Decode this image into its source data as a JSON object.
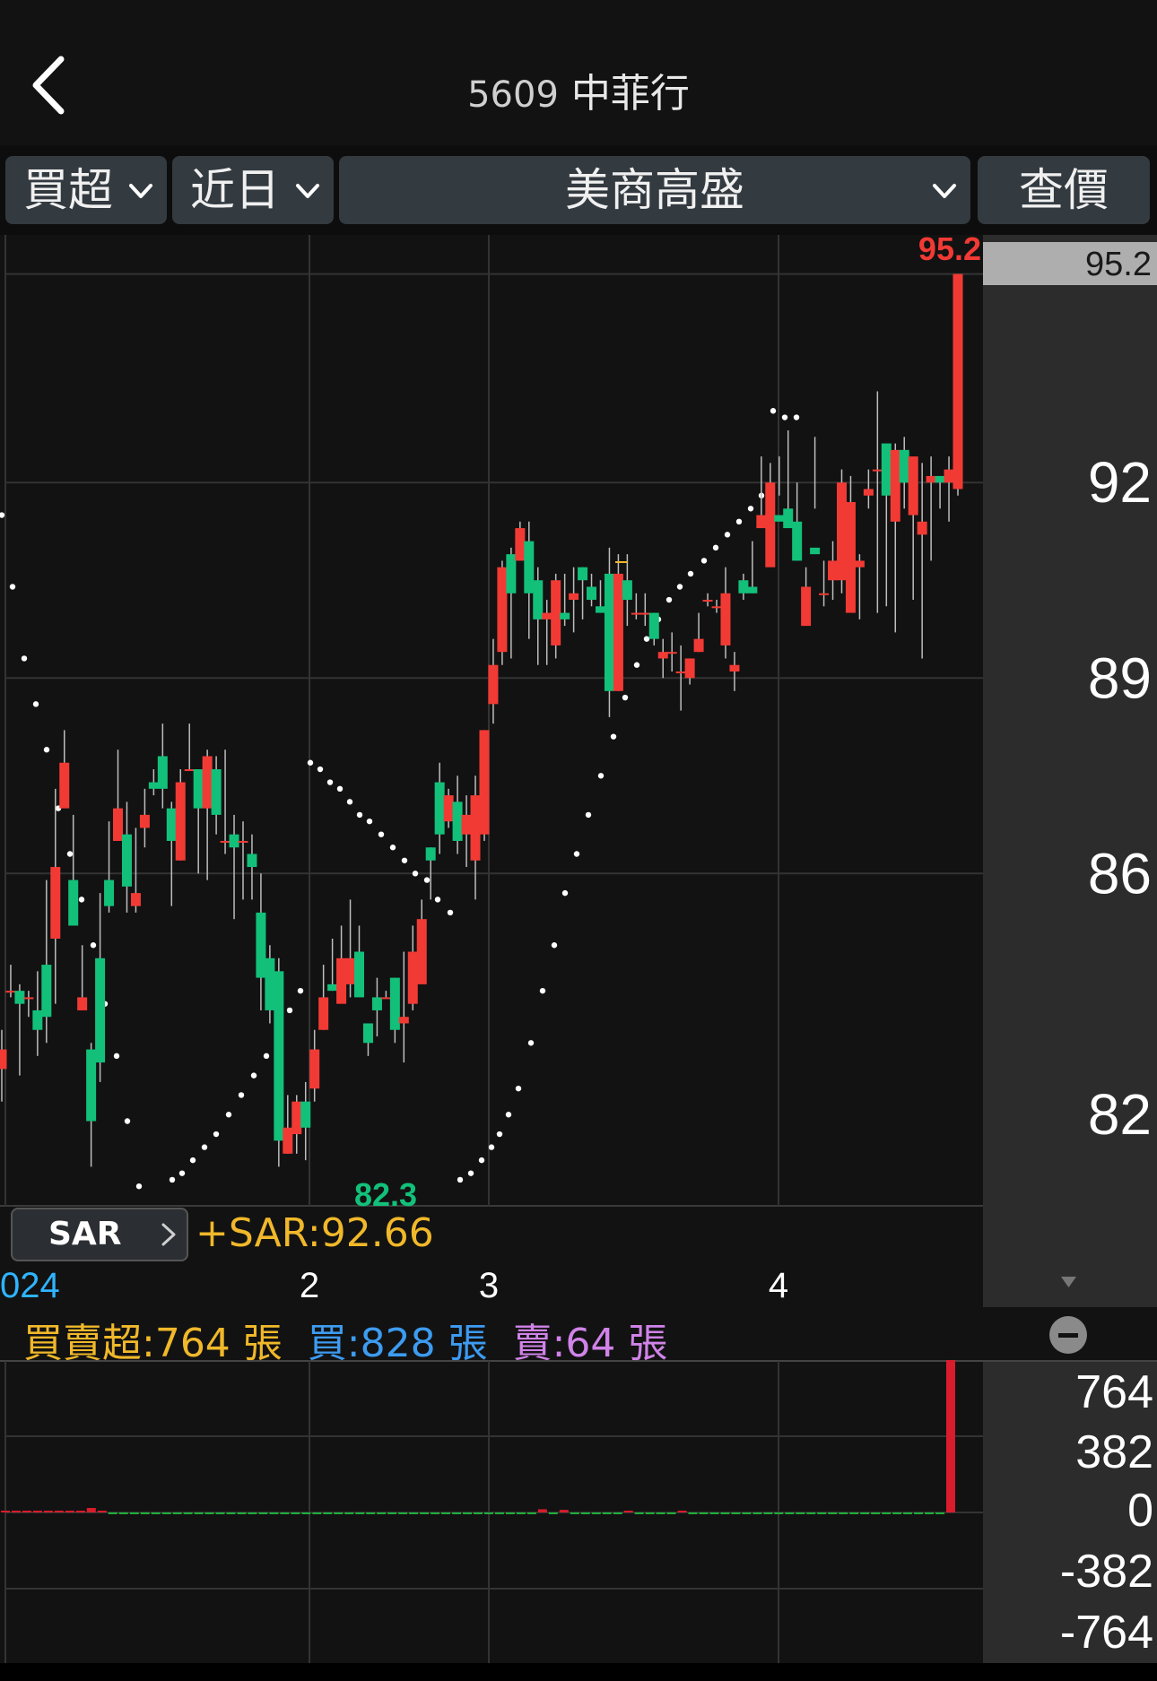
{
  "header": {
    "code": "5609",
    "name": "中菲行"
  },
  "toolbar": {
    "mode": "買超",
    "period": "近日",
    "broker": "美商高盛",
    "query": "查價"
  },
  "price_axis": {
    "labels": [
      "95.2",
      "92",
      "89",
      "86",
      "82"
    ],
    "current_price": "95.2",
    "high_label": "95.2",
    "low_label": "82.3"
  },
  "date_axis": [
    "024",
    "2",
    "3",
    "4"
  ],
  "sar": {
    "button": "SAR",
    "value": "+SAR:92.66"
  },
  "volume_legend": {
    "net": "買賣超:764 張",
    "buy": "買:828 張",
    "sell": "賣:64 張"
  },
  "volume_axis": [
    "764",
    "382",
    "0",
    "-382",
    "-764"
  ],
  "colors": {
    "up": "#f23a35",
    "down": "#12c07a",
    "sar": "#f0b82a",
    "buy": "#3d9bf0",
    "sell": "#d083e8"
  },
  "chart_data": {
    "type": "candlestick",
    "yrange": [
      80.9,
      95.8
    ],
    "candles": [
      [
        83.0,
        83.3,
        83.6,
        82.5
      ],
      [
        84.2,
        84.2,
        84.6,
        84.1
      ],
      [
        84.2,
        84.0,
        84.3,
        82.9
      ],
      [
        84.1,
        84.1,
        84.2,
        83.8
      ],
      [
        83.9,
        83.6,
        84.5,
        83.2
      ],
      [
        84.6,
        83.8,
        85.9,
        83.4
      ],
      [
        85.0,
        86.1,
        87.3,
        84.0
      ],
      [
        87.0,
        87.7,
        88.2,
        87.7
      ],
      [
        85.9,
        85.2,
        86.9,
        85.5
      ],
      [
        83.9,
        84.1,
        84.9,
        84.1
      ],
      [
        83.3,
        82.2,
        83.4,
        81.5
      ],
      [
        84.7,
        83.1,
        85.7,
        82.8
      ],
      [
        85.9,
        85.5,
        86.8,
        85.4
      ],
      [
        86.5,
        87.0,
        87.9,
        86.8
      ],
      [
        86.6,
        85.8,
        87.1,
        85.4
      ],
      [
        85.5,
        85.7,
        86.7,
        85.4
      ],
      [
        86.7,
        86.9,
        87.3,
        86.4
      ],
      [
        87.4,
        87.3,
        87.6,
        87.2
      ],
      [
        87.8,
        87.3,
        88.3,
        87.0
      ],
      [
        87.0,
        86.5,
        87.1,
        85.5
      ],
      [
        86.2,
        87.4,
        87.6,
        86.2
      ],
      [
        87.6,
        87.6,
        88.3,
        87.6
      ],
      [
        87.6,
        87.0,
        87.6,
        86.0
      ],
      [
        87.0,
        87.8,
        87.9,
        85.9
      ],
      [
        87.6,
        86.9,
        87.8,
        86.6
      ],
      [
        86.5,
        86.5,
        87.9,
        86.3
      ],
      [
        86.6,
        86.4,
        86.9,
        85.3
      ],
      [
        86.5,
        86.5,
        86.8,
        85.6
      ],
      [
        86.3,
        86.1,
        86.6,
        85.6
      ],
      [
        85.4,
        84.4,
        86.0,
        83.9
      ],
      [
        84.7,
        83.9,
        84.9,
        83.7
      ],
      [
        84.5,
        81.9,
        84.7,
        81.5
      ],
      [
        81.7,
        82.1,
        82.6,
        81.7
      ],
      [
        82.0,
        82.5,
        82.6,
        81.7
      ],
      [
        82.5,
        82.1,
        82.8,
        81.6
      ],
      [
        82.7,
        83.3,
        83.6,
        82.5
      ],
      [
        83.6,
        84.1,
        84.6,
        83.6
      ],
      [
        84.3,
        84.2,
        85.0,
        84.2
      ],
      [
        84.0,
        84.7,
        85.2,
        84.1
      ],
      [
        84.3,
        84.7,
        85.6,
        84.1
      ],
      [
        84.8,
        84.1,
        85.2,
        84.4
      ],
      [
        83.7,
        83.4,
        83.7,
        83.2
      ],
      [
        84.1,
        83.9,
        84.4,
        83.5
      ],
      [
        84.1,
        84.1,
        84.2,
        84.1
      ],
      [
        84.4,
        83.6,
        84.4,
        83.4
      ],
      [
        83.7,
        83.8,
        84.8,
        83.1
      ],
      [
        84.0,
        84.8,
        85.2,
        83.9
      ],
      [
        84.3,
        85.3,
        85.6,
        84.6
      ],
      [
        86.4,
        86.2,
        86.4,
        85.6
      ],
      [
        87.4,
        86.6,
        87.7,
        86.3
      ],
      [
        86.8,
        87.2,
        87.3,
        86.7
      ],
      [
        87.1,
        86.5,
        87.5,
        86.3
      ],
      [
        86.6,
        86.9,
        87.2,
        86.1
      ],
      [
        86.2,
        87.2,
        87.5,
        85.6
      ],
      [
        86.6,
        88.2,
        88.2,
        86.5
      ],
      [
        88.6,
        89.2,
        89.6,
        88.3
      ],
      [
        89.4,
        90.7,
        90.8,
        89.2
      ],
      [
        90.9,
        90.3,
        91.0,
        89.3
      ],
      [
        90.8,
        91.3,
        91.4,
        90.9
      ],
      [
        91.1,
        90.3,
        91.4,
        89.6
      ],
      [
        90.5,
        89.9,
        90.7,
        89.2
      ],
      [
        89.9,
        90.0,
        90.2,
        89.2
      ],
      [
        89.5,
        90.5,
        90.6,
        89.3
      ],
      [
        90.0,
        89.9,
        90.6,
        89.8
      ],
      [
        90.2,
        90.3,
        90.7,
        89.7
      ],
      [
        90.7,
        90.5,
        90.7,
        89.9
      ],
      [
        90.4,
        90.2,
        90.6,
        90.1
      ],
      [
        90.1,
        90.0,
        90.5,
        90.0
      ],
      [
        90.6,
        88.8,
        91.0,
        88.4
      ],
      [
        88.8,
        90.6,
        90.9,
        88.8
      ],
      [
        90.5,
        90.2,
        90.9,
        89.8
      ],
      [
        90.0,
        90.0,
        90.3,
        89.9
      ],
      [
        90.0,
        90.0,
        90.3,
        89.8
      ],
      [
        90.0,
        89.6,
        90.0,
        89.5
      ],
      [
        89.3,
        89.4,
        89.6,
        89.0
      ],
      [
        89.4,
        89.4,
        89.7,
        89.1
      ],
      [
        89.1,
        89.1,
        89.5,
        88.5
      ],
      [
        89.0,
        89.3,
        89.3,
        88.9
      ],
      [
        89.4,
        89.6,
        90.0,
        89.4
      ],
      [
        90.2,
        90.2,
        90.3,
        90.1
      ],
      [
        90.1,
        90.1,
        90.2,
        90.0
      ],
      [
        89.5,
        90.3,
        90.7,
        89.3
      ],
      [
        89.1,
        89.2,
        89.4,
        88.8
      ],
      [
        90.5,
        90.3,
        90.6,
        90.2
      ],
      [
        90.4,
        90.3,
        91.1,
        90.3
      ],
      [
        91.3,
        91.5,
        92.4,
        91.5
      ],
      [
        90.7,
        92.0,
        92.3,
        91.1
      ],
      [
        91.5,
        91.4,
        92.4,
        91.8
      ],
      [
        91.6,
        91.3,
        92.8,
        91.4
      ],
      [
        91.4,
        90.8,
        92.0,
        90.8
      ],
      [
        89.8,
        90.4,
        90.7,
        89.9
      ],
      [
        91.0,
        90.9,
        92.7,
        91.6
      ],
      [
        90.3,
        90.3,
        90.8,
        90.1
      ],
      [
        90.5,
        90.8,
        91.1,
        90.2
      ],
      [
        90.5,
        92.0,
        92.2,
        90.3
      ],
      [
        90.0,
        91.7,
        92.1,
        90.3
      ],
      [
        90.7,
        90.8,
        90.9,
        89.9
      ],
      [
        91.8,
        91.9,
        92.2,
        91.6
      ],
      [
        92.2,
        92.2,
        93.4,
        90.0
      ],
      [
        92.6,
        91.8,
        92.5,
        90.1
      ],
      [
        91.4,
        92.5,
        92.6,
        89.7
      ],
      [
        92.5,
        92.0,
        92.7,
        91.6
      ],
      [
        91.5,
        92.4,
        92.2,
        90.2
      ],
      [
        91.2,
        91.4,
        92.3,
        89.3
      ],
      [
        92.0,
        92.1,
        92.4,
        90.8
      ],
      [
        92.1,
        92.0,
        92.1,
        91.6
      ],
      [
        92.0,
        92.2,
        92.4,
        91.4
      ],
      [
        91.9,
        95.2,
        95.2,
        91.8
      ]
    ],
    "net_volume": [
      2,
      2,
      3,
      1,
      3,
      1,
      0,
      2,
      14,
      1,
      -3,
      -2,
      -2,
      -1,
      -3,
      -2,
      -2,
      -3,
      -1,
      -3,
      -2,
      -3,
      -3,
      -4,
      -5,
      -4,
      -5,
      -3,
      -2,
      -2,
      -1,
      -2,
      -2,
      -2,
      -1,
      -2,
      -2,
      -1,
      -3,
      -1,
      -3,
      -2,
      -1,
      -2,
      -1,
      -2,
      -1,
      -2,
      -1,
      -2,
      10,
      -1,
      8,
      -1,
      -2,
      -3,
      -1,
      -2,
      5,
      -1,
      -2,
      -2,
      -1,
      3,
      -1,
      -1,
      -1,
      -2,
      -1,
      -1,
      -2,
      -1,
      -1,
      -2,
      -1,
      -1,
      -3,
      -1,
      -1,
      -2,
      -1,
      -1,
      -1,
      -2,
      -1,
      -1,
      -2,
      -1,
      764
    ],
    "sar_points": [
      [
        2,
        91.5
      ],
      [
        14,
        90.4
      ],
      [
        27,
        89.3
      ],
      [
        40,
        88.6
      ],
      [
        52,
        87.9
      ],
      [
        65,
        87.0
      ],
      [
        78,
        86.3
      ],
      [
        91,
        85.6
      ],
      [
        104,
        84.9
      ],
      [
        117,
        84.0
      ],
      [
        130,
        83.2
      ],
      [
        142,
        82.2
      ],
      [
        155,
        81.2
      ],
      [
        192,
        81.3
      ],
      [
        203,
        81.4
      ],
      [
        215,
        81.6
      ],
      [
        228,
        81.8
      ],
      [
        241,
        82.0
      ],
      [
        255,
        82.3
      ],
      [
        269,
        82.6
      ],
      [
        283,
        82.9
      ],
      [
        297,
        83.2
      ],
      [
        310,
        83.5
      ],
      [
        323,
        83.9
      ],
      [
        335,
        84.2
      ],
      [
        346,
        87.7
      ],
      [
        357,
        87.6
      ],
      [
        368,
        87.4
      ],
      [
        379,
        87.3
      ],
      [
        390,
        87.1
      ],
      [
        401,
        86.9
      ],
      [
        412,
        86.8
      ],
      [
        425,
        86.6
      ],
      [
        438,
        86.4
      ],
      [
        451,
        86.2
      ],
      [
        463,
        86.0
      ],
      [
        476,
        85.9
      ],
      [
        488,
        85.6
      ],
      [
        502,
        85.4
      ],
      [
        513,
        81.3
      ],
      [
        525,
        81.4
      ],
      [
        537,
        81.6
      ],
      [
        548,
        81.8
      ],
      [
        557,
        82.0
      ],
      [
        567,
        82.3
      ],
      [
        578,
        82.7
      ],
      [
        592,
        83.4
      ],
      [
        605,
        84.2
      ],
      [
        618,
        84.9
      ],
      [
        630,
        85.7
      ],
      [
        643,
        86.3
      ],
      [
        656,
        86.9
      ],
      [
        670,
        87.5
      ],
      [
        684,
        88.1
      ],
      [
        697,
        88.7
      ],
      [
        710,
        89.2
      ],
      [
        721,
        89.6
      ],
      [
        734,
        89.9
      ],
      [
        746,
        90.2
      ],
      [
        758,
        90.4
      ],
      [
        770,
        90.6
      ],
      [
        785,
        90.8
      ],
      [
        798,
        91.0
      ],
      [
        811,
        91.2
      ],
      [
        824,
        91.4
      ],
      [
        837,
        91.6
      ],
      [
        849,
        91.8
      ],
      [
        862,
        93.1
      ],
      [
        875,
        93.0
      ],
      [
        888,
        93.0
      ]
    ]
  }
}
